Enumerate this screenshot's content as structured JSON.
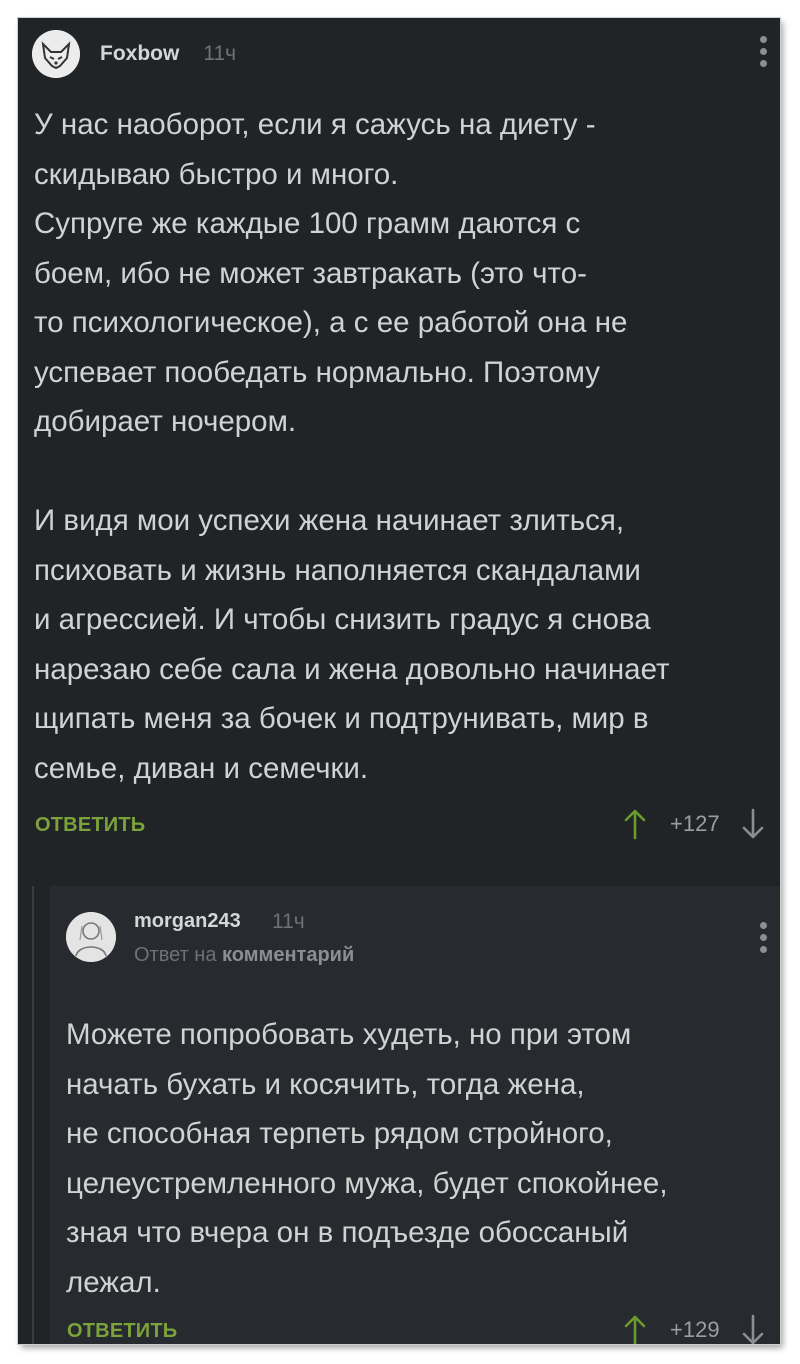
{
  "comment": {
    "author": "Foxbow",
    "time": "11ч",
    "text": "У нас наоборот, если я сажусь на диету -\nскидываю быстро и много.\nСупруге же каждые 100 грамм даются с\nбоем, ибо не может завтракать (это что-\nто психологическое), а с ее работой она не\nуспевает пообедать нормально. Поэтому\nдобирает ночером.\n\nИ видя мои успехи жена начинает злиться,\nпсиховать и жизнь наполняется скандалами\nи агрессией. И чтобы снизить градус я снова\nнарезаю себе сала и жена довольно начинает\nщипать меня за бочек и подтрунивать, мир в\nсемье, диван и семечки.",
    "reply_label": "ОТВЕТИТЬ",
    "rating": "+127",
    "icons": {
      "avatar": "fox-avatar-icon",
      "menu": "more-vertical-icon",
      "up": "arrow-up-icon",
      "down": "arrow-down-icon"
    }
  },
  "reply": {
    "author": "morgan243",
    "time": "11ч",
    "reply_prefix": "Ответ на",
    "reply_target": "комментарий",
    "text": "Можете попробовать худеть, но при этом\nначать бухать и косячить, тогда жена,\nне способная терпеть рядом стройного,\nцелеустремленного мужа, будет спокойнее,\nзная что вчера он в подъезде обоссаный\nлежал.",
    "reply_label": "ОТВЕТИТЬ",
    "rating": "+129",
    "icons": {
      "avatar": "user-avatar-icon",
      "menu": "more-vertical-icon",
      "up": "arrow-up-icon",
      "down": "arrow-down-icon"
    }
  },
  "colors": {
    "background": "#212427",
    "reply_background": "#272a2e",
    "text": "#d2d2d2",
    "accent_green": "#7ba23b",
    "muted": "#6e7175"
  }
}
